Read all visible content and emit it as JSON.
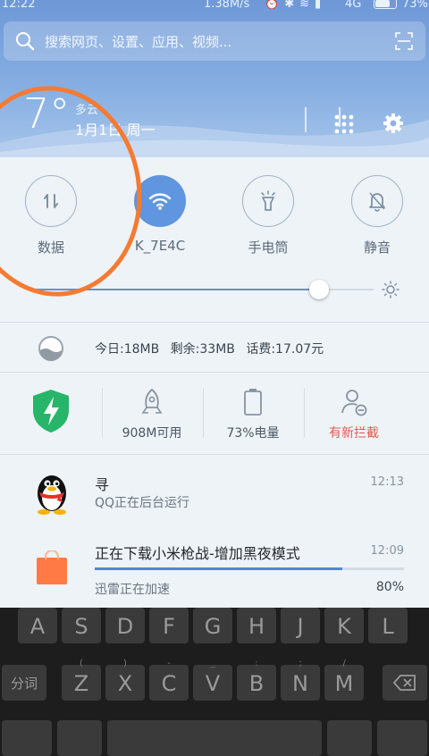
{
  "status_bar": {
    "time": "12:22",
    "net_speed": "1.38M/s",
    "network": "4G",
    "battery": "73%"
  },
  "search": {
    "placeholder": "搜索网页、设置、应用、视频..."
  },
  "weather": {
    "temp": "7°",
    "condition": "多云",
    "date": "1月1日 周一"
  },
  "toggles": [
    {
      "label": "数据",
      "icon": "data-arrows-icon",
      "active": false
    },
    {
      "label": "K_7E4C",
      "icon": "wifi-icon",
      "active": true
    },
    {
      "label": "手电筒",
      "icon": "flashlight-icon",
      "active": false
    },
    {
      "label": "静音",
      "icon": "mute-bell-icon",
      "active": false
    }
  ],
  "brightness": {
    "level": 0.84
  },
  "data_usage": {
    "today": "今日:18MB",
    "remaining": "剩余:33MB",
    "balance": "话费:17.07元"
  },
  "security": {
    "memory": "908M可用",
    "battery": "73%电量",
    "intercept": "有新拦截",
    "intercept_color": "#e8584e"
  },
  "notifications": [
    {
      "title": "寻",
      "subtitle": "QQ正在后台运行",
      "time": "12:13"
    },
    {
      "title": "正在下载小米枪战-增加黑夜模式",
      "subtitle": "迅雷正在加速",
      "time": "12:09",
      "progress": 0.8,
      "progress_label": "80%"
    }
  ],
  "keyboard": {
    "row1": [
      {
        "k": "A",
        "s": ""
      },
      {
        "k": "S",
        "s": ""
      },
      {
        "k": "D",
        "s": ""
      },
      {
        "k": "F",
        "s": ""
      },
      {
        "k": "G",
        "s": ""
      },
      {
        "k": "H",
        "s": ""
      },
      {
        "k": "J",
        "s": ""
      },
      {
        "k": "K",
        "s": ""
      },
      {
        "k": "L",
        "s": ""
      }
    ],
    "row2_left": "分词",
    "row2": [
      {
        "k": "Z",
        "s": "("
      },
      {
        "k": "X",
        "s": ")"
      },
      {
        "k": "C",
        "s": "-"
      },
      {
        "k": "V",
        "s": "_"
      },
      {
        "k": "B",
        "s": ":"
      },
      {
        "k": "N",
        "s": ";"
      },
      {
        "k": "M",
        "s": "/"
      }
    ]
  },
  "colors": {
    "accent": "#5f96df",
    "annotation": "#f47b33"
  }
}
